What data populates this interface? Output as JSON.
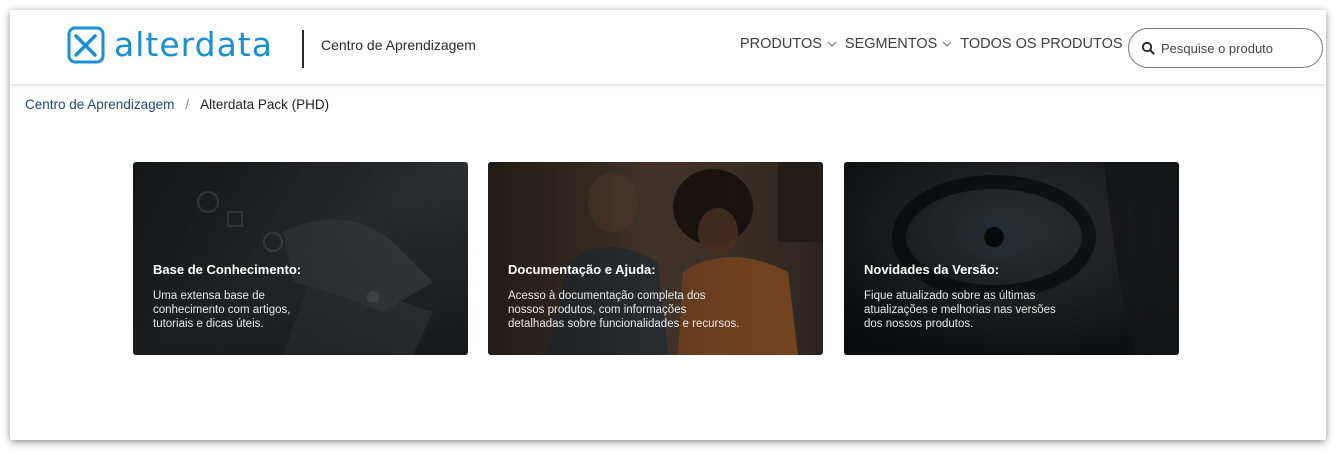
{
  "header": {
    "logo_text": "alterdata",
    "site_name": "Centro de Aprendizagem",
    "nav": [
      {
        "label": "PRODUTOS"
      },
      {
        "label": "SEGMENTOS"
      },
      {
        "label": "TODOS OS PRODUTOS"
      }
    ],
    "search": {
      "placeholder": "Pesquise o produto",
      "value": ""
    }
  },
  "breadcrumb": {
    "root": "Centro de Aprendizagem",
    "separator": "/",
    "current": "Alterdata Pack (PHD)"
  },
  "cards": [
    {
      "title": "Base de Conhecimento:",
      "desc_lines": [
        "Uma extensa base de",
        "conhecimento com artigos,",
        "tutoriais e dicas úteis."
      ]
    },
    {
      "title": "Documentação e Ajuda:",
      "desc_lines": [
        "Acesso à documentação completa dos",
        "nossos produtos, com informações",
        "detalhadas sobre funcionalidades e recursos."
      ]
    },
    {
      "title": "Novidades da Versão:",
      "desc_lines": [
        "Fique atualizado sobre as últimas",
        "atualizações e melhorias nas versões",
        "dos nossos produtos."
      ]
    }
  ],
  "icons": {
    "logo": "alterdata-logo-icon",
    "search": "search-icon",
    "chevron": "chevron-down-icon"
  },
  "colors": {
    "brand": "#1a8fd6",
    "link": "#1b4a73"
  }
}
